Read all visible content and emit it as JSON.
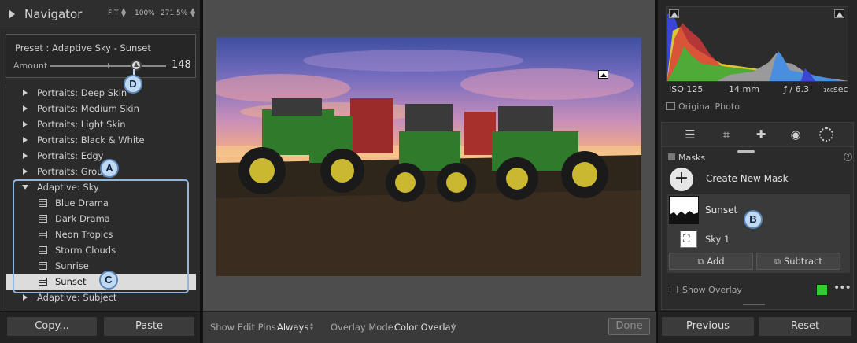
{
  "navigator": {
    "title": "Navigator",
    "zoom_fit": "FIT",
    "zoom_100": "100%",
    "zoom_custom": "271.5%"
  },
  "preset": {
    "name": "Preset : Adaptive Sky - Sunset",
    "amount_label": "Amount",
    "amount_value": "148",
    "amount_fraction": 0.74
  },
  "preset_list": {
    "groups_before": [
      "Portraits: Deep Skin",
      "Portraits: Medium Skin",
      "Portraits: Light Skin",
      "Portraits: Black & White",
      "Portraits: Edgy",
      "Portraits: Group"
    ],
    "open_group": "Adaptive: Sky",
    "open_items": [
      "Blue Drama",
      "Dark Drama",
      "Neon Tropics",
      "Storm Clouds",
      "Sunrise",
      "Sunset"
    ],
    "selected_item": "Sunset",
    "groups_after": [
      "Adaptive: Subject"
    ]
  },
  "callouts": {
    "a": "A",
    "b": "B",
    "c": "C",
    "d": "D"
  },
  "left_buttons": {
    "copy": "Copy...",
    "paste": "Paste"
  },
  "toolbar": {
    "edit_pins_label": "Show Edit Pins:",
    "edit_pins_value": "Always",
    "overlay_mode_label": "Overlay Mode:",
    "overlay_mode_value": "Color Overlay",
    "done_label": "Done"
  },
  "exif": {
    "iso": "ISO 125",
    "focal": "14 mm",
    "aperture": "ƒ / 6.3",
    "shutter_num": "1",
    "shutter_den": "160",
    "shutter_unit": "sec"
  },
  "original_photo_label": "Original Photo",
  "masks": {
    "header": "Masks",
    "help": "?",
    "create_label": "Create New Mask",
    "create_symbol": "+",
    "mask_name": "Sunset",
    "component_name": "Sky 1",
    "add_label": "Add",
    "subtract_label": "Subtract",
    "show_overlay_label": "Show Overlay",
    "overlay_color": "#33cc33",
    "more": "•••"
  },
  "right_buttons": {
    "previous": "Previous",
    "reset": "Reset"
  },
  "icons": {
    "tools": [
      "sliders-icon",
      "crop-icon",
      "healing-icon",
      "red-eye-icon",
      "masking-icon"
    ]
  }
}
